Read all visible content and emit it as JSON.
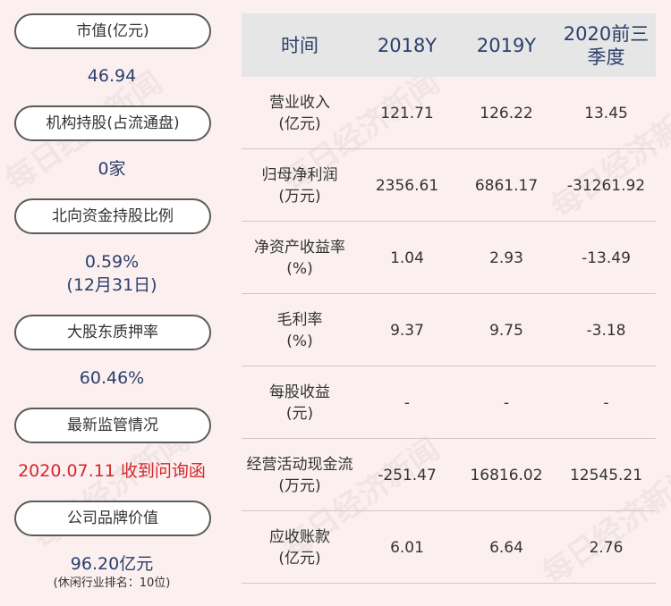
{
  "left_panel": {
    "items": [
      {
        "label": "市值(亿元)",
        "value": "46.94"
      },
      {
        "label": "机构持股(占流通盘)",
        "value": "0家"
      },
      {
        "label": "北向资金持股比例",
        "value": "0.59%",
        "value2": "(12月31日)"
      },
      {
        "label": "大股东质押率",
        "value": "60.46%"
      },
      {
        "label": "最新监管情况",
        "value": "2020.07.11 收到问询函"
      },
      {
        "label": "公司品牌价值",
        "value": "96.20亿元",
        "value2": "(休闲行业排名：10位)"
      }
    ]
  },
  "table": {
    "headers": [
      "时间",
      "2018Y",
      "2019Y",
      "2020前三季度"
    ],
    "rows": [
      {
        "label": "营业收入",
        "unit": "(亿元)",
        "values": [
          "121.71",
          "126.22",
          "13.45"
        ]
      },
      {
        "label": "归母净利润",
        "unit": "(万元)",
        "values": [
          "2356.61",
          "6861.17",
          "-31261.92"
        ]
      },
      {
        "label": "净资产收益率",
        "unit": "(%)",
        "values": [
          "1.04",
          "2.93",
          "-13.49"
        ]
      },
      {
        "label": "毛利率",
        "unit": "(%)",
        "values": [
          "9.37",
          "9.75",
          "-3.18"
        ]
      },
      {
        "label": "每股收益",
        "unit": "(元)",
        "values": [
          "-",
          "-",
          "-"
        ]
      },
      {
        "label": "经营活动现金流",
        "unit": "(万元)",
        "values": [
          "-251.47",
          "16816.02",
          "12545.21"
        ]
      },
      {
        "label": "应收账款",
        "unit": "(亿元)",
        "values": [
          "6.01",
          "6.64",
          "2.76"
        ]
      }
    ]
  },
  "watermark": "每日经济新闻",
  "colors": {
    "background": "#fbf0ef",
    "value_blue": "#2b3f6b",
    "alert_red": "#d7262b",
    "header_gray": "#e6e6e6"
  }
}
